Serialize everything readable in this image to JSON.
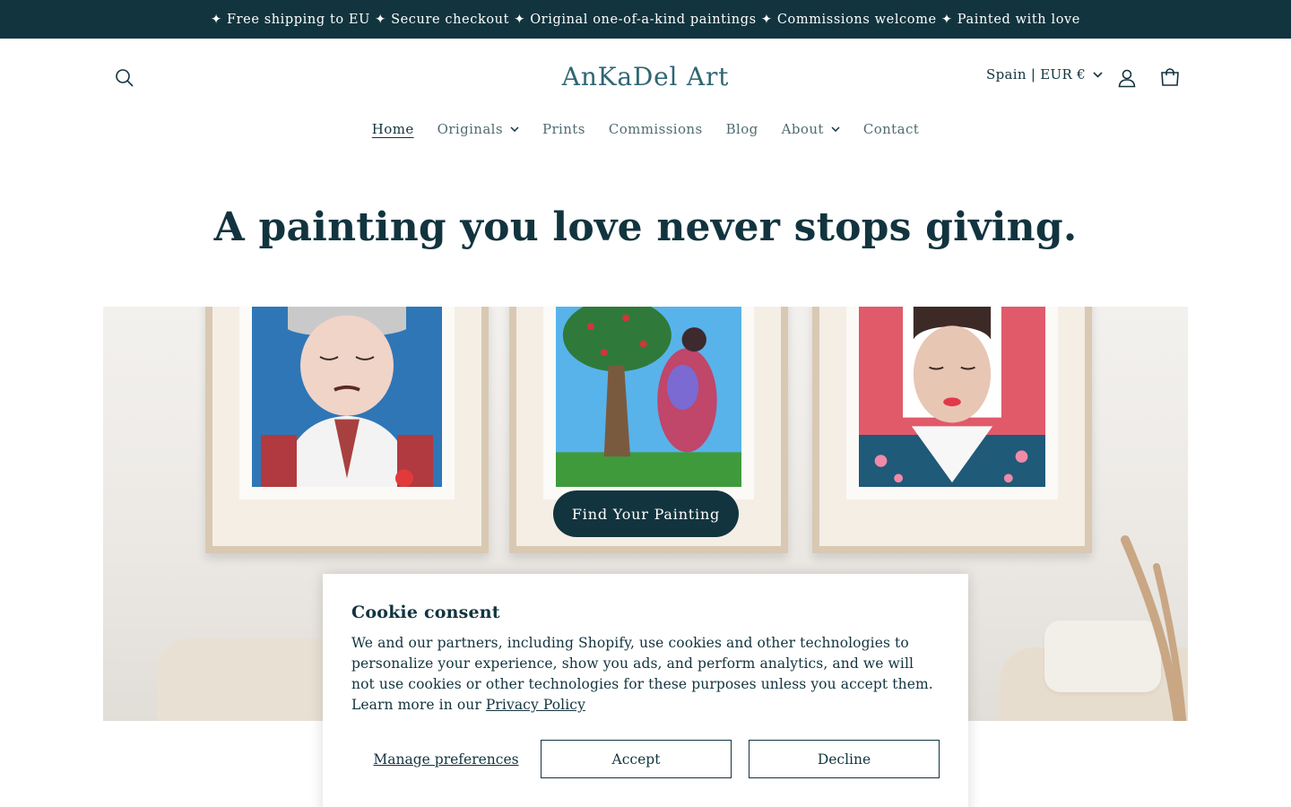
{
  "announcement": {
    "text": "✦ Free shipping to EU ✦ Secure checkout ✦ Original one-of-a-kind paintings ✦ Commissions welcome ✦ Painted with love"
  },
  "header": {
    "logo": "AnKaDel Art",
    "locale": "Spain | EUR €",
    "icons": [
      "search-icon",
      "account-icon",
      "cart-icon"
    ]
  },
  "nav": {
    "items": [
      {
        "label": "Home",
        "active": true,
        "dropdown": false
      },
      {
        "label": "Originals",
        "active": false,
        "dropdown": true
      },
      {
        "label": "Prints",
        "active": false,
        "dropdown": false
      },
      {
        "label": "Commissions",
        "active": false,
        "dropdown": false
      },
      {
        "label": "Blog",
        "active": false,
        "dropdown": false
      },
      {
        "label": "About",
        "active": false,
        "dropdown": true
      },
      {
        "label": "Contact",
        "active": false,
        "dropdown": false
      }
    ]
  },
  "hero": {
    "title": "A painting you love never stops giving.",
    "cta_label": "Find Your Painting"
  },
  "cookie": {
    "title": "Cookie consent",
    "body": "We and our partners, including Shopify, use cookies and other technologies to personalize your experience, show you ads, and perform analytics, and we will not use cookies or other technologies for these purposes unless you accept them. Learn more in our",
    "link_label": "Privacy Policy",
    "manage_label": "Manage preferences",
    "accept_label": "Accept",
    "decline_label": "Decline"
  },
  "colors": {
    "brand_dark": "#12343f",
    "logo": "#2f6673",
    "nav_text": "#4f6b72"
  }
}
